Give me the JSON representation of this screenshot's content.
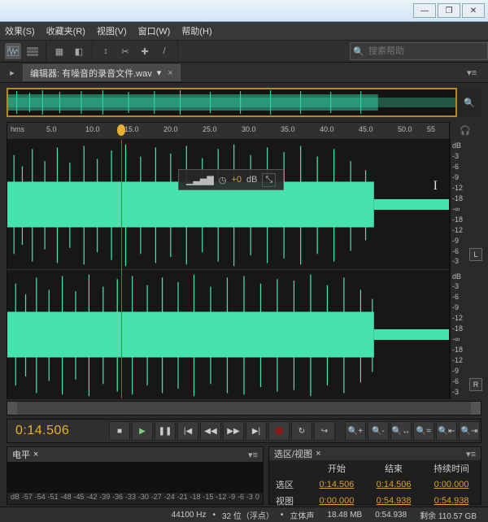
{
  "menubar": {
    "items": [
      "效果(S)",
      "收藏夹(R)",
      "视图(V)",
      "窗口(W)",
      "帮助(H)"
    ]
  },
  "search": {
    "placeholder": "搜索帮助"
  },
  "editor": {
    "tab_prefix": "编辑器:",
    "filename": "有噪音的录音文件.wav"
  },
  "ruler": {
    "unit": "hms",
    "ticks": [
      "5.0",
      "10.0",
      "15.0",
      "20.0",
      "25.0",
      "30.0",
      "35.0",
      "40.0",
      "45.0",
      "50.0",
      "55"
    ]
  },
  "playhead_sec": 14.506,
  "total_sec": 54.938,
  "hud": {
    "db_label": "+0",
    "db_unit": "dB"
  },
  "db_marks": [
    "dB",
    "-3",
    "-6",
    "-9",
    "-12",
    "-18",
    "-∞",
    "-18",
    "-12",
    "-9",
    "-6",
    "-3"
  ],
  "channel_badge": {
    "left": "L",
    "right": "R"
  },
  "timecode": "0:14.506",
  "transport": {
    "labels": {
      "stop": "■",
      "play": "▶",
      "pause": "❚❚",
      "begin": "|◀",
      "rew": "◀◀",
      "fwd": "▶▶",
      "end": "▶|",
      "loop": "↻",
      "skip": "↪"
    }
  },
  "zoom": {
    "labels": [
      "🔍+",
      "🔍-",
      "🔍↔",
      "🔍=",
      "🔍⇤",
      "🔍⇥"
    ]
  },
  "levels": {
    "title": "电平",
    "scale": [
      "dB",
      "-57",
      "-54",
      "-51",
      "-48",
      "-45",
      "-42",
      "-39",
      "-36",
      "-33",
      "-30",
      "-27",
      "-24",
      "-21",
      "-18",
      "-15",
      "-12",
      "-9",
      "-6",
      "-3",
      "0"
    ]
  },
  "selection": {
    "title": "选区/视图",
    "headers": [
      "",
      "开始",
      "结束",
      "持续时间"
    ],
    "rows": [
      {
        "label": "选区",
        "start": "0:14.506",
        "end": "0:14.506",
        "dur": "0:00.000"
      },
      {
        "label": "视图",
        "start": "0:00.000",
        "end": "0:54.938",
        "dur": "0:54.938"
      }
    ]
  },
  "status": {
    "sample": "44100 Hz",
    "bits": "32 位（浮点）",
    "chan": "立体声",
    "size": "18.48 MB",
    "dur": "0:54.938",
    "disk": "剩余 110.57 GB"
  },
  "chart_data": {
    "type": "waveform",
    "channels": 2,
    "x_unit": "seconds",
    "x_range": [
      0,
      54.938
    ],
    "y_unit": "dB",
    "y_marks": [
      -3,
      -6,
      -9,
      -12,
      -18
    ],
    "description": "Stereo audio waveform, dense signal ~0-45s tapering after ~45s, both channels visually similar",
    "playhead": 14.506
  }
}
